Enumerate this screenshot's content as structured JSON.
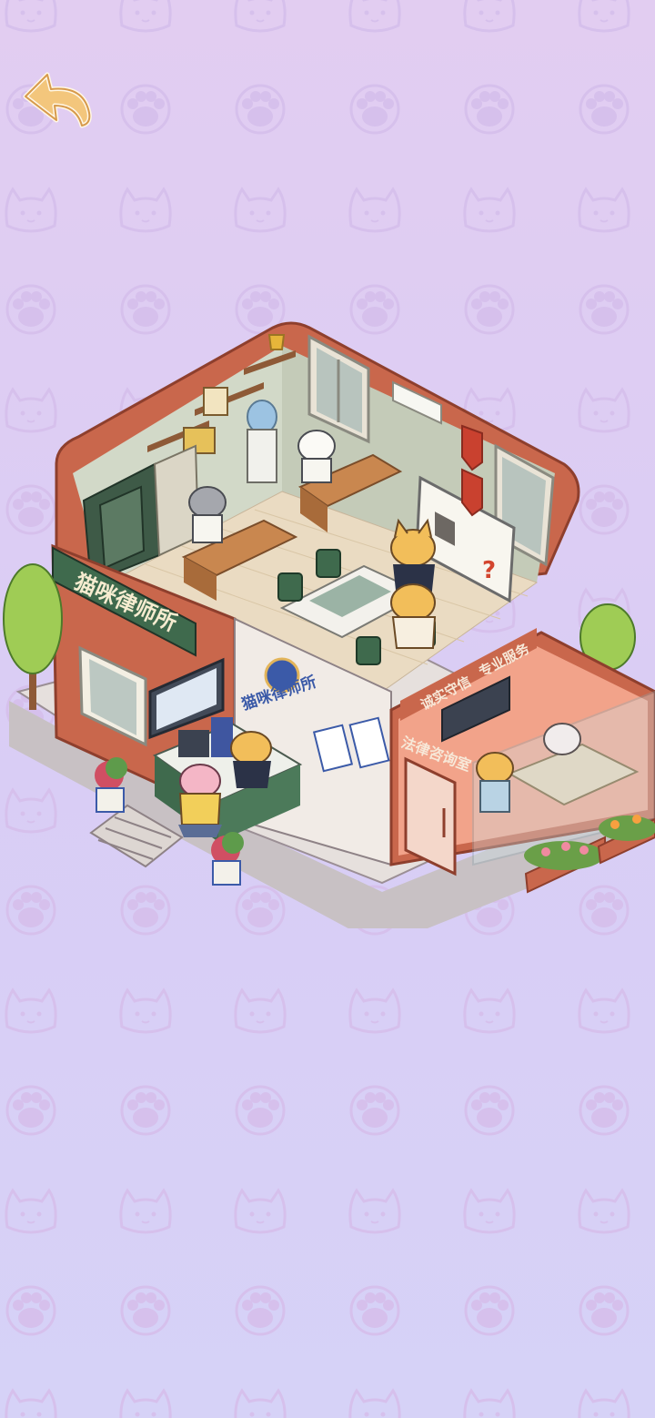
{
  "colors": {
    "background_top": "#e2cdf1",
    "background_bottom": "#d6d2f7",
    "pattern": "#d3bde9",
    "wall_brick": "#c9674c",
    "wall_dark": "#a94f3a",
    "floor": "#eadbc2",
    "sign_green": "#3f6a4d",
    "sign_text": "#f6ecd0",
    "window_frame": "#e9e3d6",
    "back_button": "#f2c37a",
    "blue_text": "#3b5aa8"
  },
  "nav": {
    "back_icon": "back-arrow-icon"
  },
  "building": {
    "sign_green": "猫咪律师所",
    "sign_reception": "猫咪律师所",
    "slogan_left": "诚实守信",
    "slogan_right": "专业服务",
    "room_label": "法律咨询室"
  }
}
